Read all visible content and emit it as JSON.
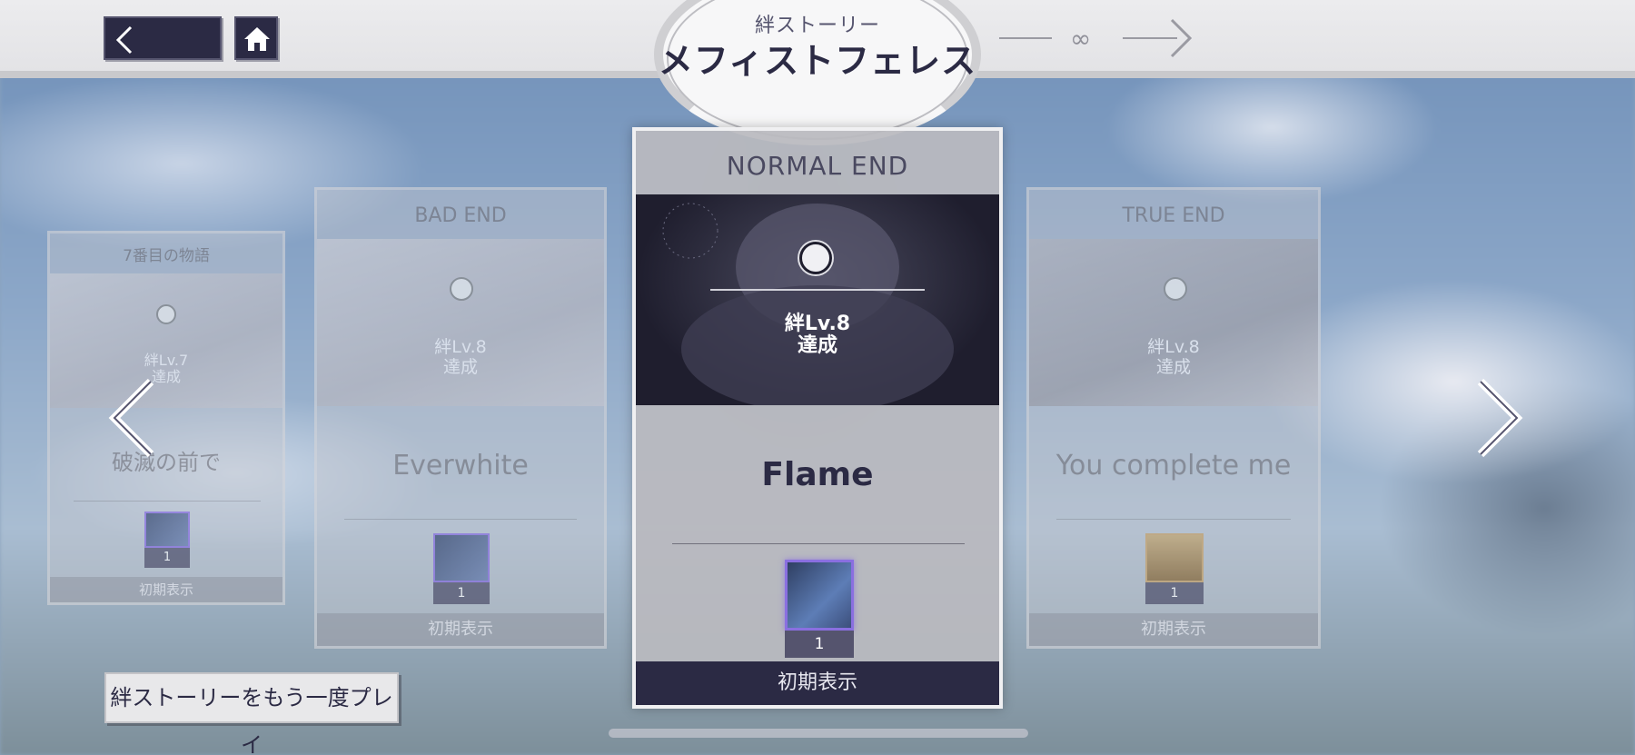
{
  "header": {
    "subtitle": "絆ストーリー",
    "title": "メフィストフェレス",
    "route_icon": "infinity-icon"
  },
  "cards": [
    {
      "end_label": "7番目の物語",
      "condition_line1": "絆Lv.7",
      "condition_line2": "達成",
      "story_title": "破滅の前で",
      "reward_count": "1",
      "footer": "初期表示"
    },
    {
      "end_label": "BAD END",
      "condition_line1": "絆Lv.8",
      "condition_line2": "達成",
      "story_title": "Everwhite",
      "reward_count": "1",
      "footer": "初期表示"
    },
    {
      "end_label": "NORMAL END",
      "condition_line1": "絆Lv.8",
      "condition_line2": "達成",
      "story_title": "Flame",
      "reward_count": "1",
      "footer": "初期表示"
    },
    {
      "end_label": "TRUE END",
      "condition_line1": "絆Lv.8",
      "condition_line2": "達成",
      "story_title": "You complete me",
      "reward_count": "1",
      "footer": "初期表示"
    }
  ],
  "replay_button": "絆ストーリーをもう一度プレイ",
  "colors": {
    "dark_navy": "#2b2a44",
    "header_bg": "#e8e8ea",
    "reward_purple": "#8a6fe0"
  }
}
